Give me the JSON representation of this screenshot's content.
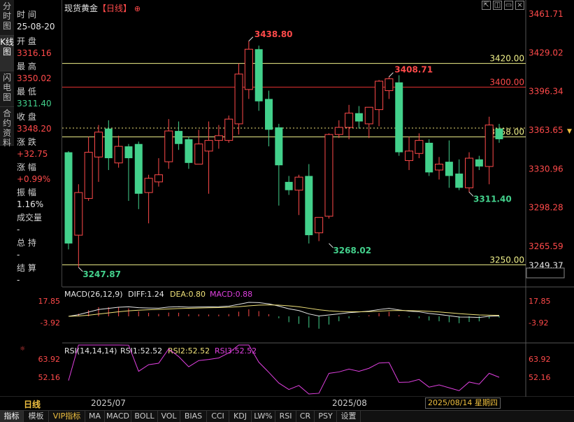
{
  "side_tabs": [
    {
      "label": "分时图",
      "active": false
    },
    {
      "label": "K线图",
      "active": true
    },
    {
      "label": "闪电图",
      "active": false
    },
    {
      "label": "合约资料",
      "active": false
    }
  ],
  "info_panel": {
    "time_label": "时 间",
    "time_value": "25-08-20",
    "open_label": "开 盘",
    "open_value": "3316.16",
    "high_label": "最 高",
    "high_value": "3350.02",
    "low_label": "最 低",
    "low_value": "3311.40",
    "close_label": "收 盘",
    "close_value": "3348.20",
    "change_label": "涨 跌",
    "change_value": "+32.75",
    "pct_label": "涨 幅",
    "pct_value": "+0.99%",
    "amp_label": "振 幅",
    "amp_value": "1.16%",
    "volume_label": "成交量",
    "volume_value": "-",
    "oi_label": "总 持",
    "oi_value": "-",
    "settle_label": "结 算",
    "settle_value": "-"
  },
  "title": {
    "name": "现货黄金",
    "period": "【日线】",
    "icon": "plus-circle-icon"
  },
  "toolbar": {
    "icons": [
      "expand-icon",
      "restore-icon",
      "window-icon",
      "close-icon"
    ]
  },
  "price_axis": {
    "ticks": [
      "3461.71",
      "3429.02",
      "3396.34",
      "3363.65",
      "3330.96",
      "3298.28",
      "3265.59",
      "3249.37"
    ]
  },
  "macd": {
    "title": "MACD(26,12,9)",
    "diff": "DIFF:1.24",
    "dea": "DEA:0.80",
    "macd": "MACD:0.88",
    "ticks": [
      "17.85",
      "-3.92"
    ]
  },
  "rsi": {
    "title": "RSI(14,14,14)",
    "rsi1": "RSI1:52.52",
    "rsi2": "RSI2:52.52",
    "rsi3": "RSI3:52.52",
    "ticks": [
      "63.92",
      "52.16"
    ]
  },
  "date_bar": {
    "period_label": "日线",
    "month1": "2025/07",
    "month2": "2025/08",
    "current": "2025/08/14 星期四"
  },
  "bottom_tabs": [
    {
      "label": "指标",
      "active": true
    },
    {
      "label": "模板",
      "active": false
    },
    {
      "label": "VIP指标",
      "active": false,
      "color": "#f0c040"
    },
    {
      "label": "MA",
      "active": false
    },
    {
      "label": "MACD",
      "active": false
    },
    {
      "label": "BOLL",
      "active": false
    },
    {
      "label": "VOL",
      "active": false
    },
    {
      "label": "BIAS",
      "active": false
    },
    {
      "label": "CCI",
      "active": false
    },
    {
      "label": "KDJ",
      "active": false
    },
    {
      "label": "LW%",
      "active": false
    },
    {
      "label": "RSI",
      "active": false
    },
    {
      "label": "CR",
      "active": false
    },
    {
      "label": "PSY",
      "active": false
    },
    {
      "label": "设置",
      "active": false
    }
  ],
  "colors": {
    "up": "#ff4a4a",
    "down": "#43d18c",
    "hline_yellow": "#f0f08a",
    "hline_red": "#e03030",
    "dea": "#f0e27a",
    "rsi": "#e040e0"
  },
  "chart_data": {
    "type": "candlestick",
    "ylim": [
      3240,
      3470
    ],
    "hlines": [
      {
        "value": 3420.0,
        "label": "3420.00",
        "color": "yellow"
      },
      {
        "value": 3400.0,
        "label": "3400.00",
        "color": "red"
      },
      {
        "value": 3358.0,
        "label": "3358.00",
        "color": "yellow"
      },
      {
        "value": 3250.0,
        "label": "3250.00",
        "color": "yellow"
      }
    ],
    "current_price": 3363.65,
    "annotations": [
      {
        "label": "3438.80",
        "value": 3438.8,
        "index": 18
      },
      {
        "label": "3408.71",
        "value": 3408.71,
        "index": 32
      },
      {
        "label": "3268.02",
        "value": 3268.02,
        "index": 26
      },
      {
        "label": "3247.87",
        "value": 3247.87,
        "index": 1
      },
      {
        "label": "3311.40",
        "value": 3311.4,
        "index": 40
      }
    ],
    "candles": [
      {
        "o": 3345,
        "h": 3346,
        "c": 3268,
        "l": 3263
      },
      {
        "o": 3275,
        "h": 3318,
        "c": 3311,
        "l": 3248
      },
      {
        "o": 3306,
        "h": 3358,
        "c": 3345,
        "l": 3304
      },
      {
        "o": 3341,
        "h": 3368,
        "c": 3362,
        "l": 3320
      },
      {
        "o": 3365,
        "h": 3372,
        "c": 3340,
        "l": 3330
      },
      {
        "o": 3336,
        "h": 3359,
        "c": 3350,
        "l": 3332
      },
      {
        "o": 3350,
        "h": 3352,
        "c": 3340,
        "l": 3304
      },
      {
        "o": 3352,
        "h": 3354,
        "c": 3310,
        "l": 3297
      },
      {
        "o": 3311,
        "h": 3326,
        "c": 3323,
        "l": 3285
      },
      {
        "o": 3320,
        "h": 3340,
        "c": 3326,
        "l": 3316
      },
      {
        "o": 3337,
        "h": 3373,
        "c": 3363,
        "l": 3331
      },
      {
        "o": 3363,
        "h": 3371,
        "c": 3352,
        "l": 3347
      },
      {
        "o": 3356,
        "h": 3358,
        "c": 3336,
        "l": 3331
      },
      {
        "o": 3335,
        "h": 3364,
        "c": 3352,
        "l": 3335
      },
      {
        "o": 3346,
        "h": 3371,
        "c": 3355,
        "l": 3310
      },
      {
        "o": 3355,
        "h": 3368,
        "c": 3359,
        "l": 3348
      },
      {
        "o": 3355,
        "h": 3376,
        "c": 3373,
        "l": 3353
      },
      {
        "o": 3369,
        "h": 3420,
        "c": 3411,
        "l": 3360
      },
      {
        "o": 3398,
        "h": 3439,
        "c": 3432,
        "l": 3390
      },
      {
        "o": 3432,
        "h": 3435,
        "c": 3388,
        "l": 3380
      },
      {
        "o": 3390,
        "h": 3397,
        "c": 3364,
        "l": 3350
      },
      {
        "o": 3366,
        "h": 3369,
        "c": 3334,
        "l": 3300
      },
      {
        "o": 3320,
        "h": 3325,
        "c": 3313,
        "l": 3309
      },
      {
        "o": 3313,
        "h": 3326,
        "c": 3324,
        "l": 3292
      },
      {
        "o": 3325,
        "h": 3335,
        "c": 3275,
        "l": 3268
      },
      {
        "o": 3277,
        "h": 3290,
        "c": 3290,
        "l": 3270
      },
      {
        "o": 3291,
        "h": 3361,
        "c": 3360,
        "l": 3289
      },
      {
        "o": 3360,
        "h": 3372,
        "c": 3366,
        "l": 3357
      },
      {
        "o": 3366,
        "h": 3385,
        "c": 3378,
        "l": 3356
      },
      {
        "o": 3378,
        "h": 3384,
        "c": 3371,
        "l": 3365
      },
      {
        "o": 3369,
        "h": 3373,
        "c": 3383,
        "l": 3357
      },
      {
        "o": 3381,
        "h": 3406,
        "c": 3405,
        "l": 3367
      },
      {
        "o": 3397,
        "h": 3409,
        "c": 3407,
        "l": 3390
      },
      {
        "o": 3404,
        "h": 3410,
        "c": 3345,
        "l": 3342
      },
      {
        "o": 3338,
        "h": 3358,
        "c": 3346,
        "l": 3330
      },
      {
        "o": 3344,
        "h": 3361,
        "c": 3355,
        "l": 3340
      },
      {
        "o": 3353,
        "h": 3356,
        "c": 3328,
        "l": 3325
      },
      {
        "o": 3330,
        "h": 3341,
        "c": 3335,
        "l": 3322
      },
      {
        "o": 3337,
        "h": 3355,
        "c": 3325,
        "l": 3315
      },
      {
        "o": 3327,
        "h": 3339,
        "c": 3315,
        "l": 3313
      },
      {
        "o": 3315,
        "h": 3345,
        "c": 3340,
        "l": 3311
      },
      {
        "o": 3339,
        "h": 3342,
        "c": 3333,
        "l": 3330
      },
      {
        "o": 3333,
        "h": 3375,
        "c": 3368,
        "l": 3318
      },
      {
        "o": 3365,
        "h": 3369,
        "c": 3356,
        "l": 3353
      }
    ]
  }
}
